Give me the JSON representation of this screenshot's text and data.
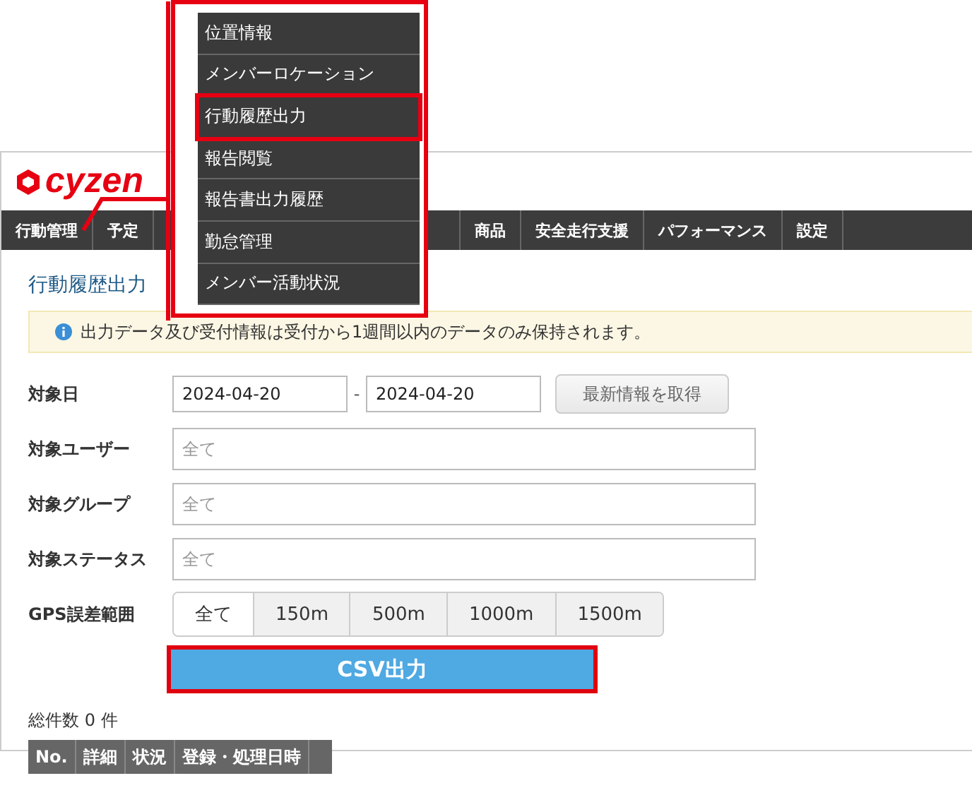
{
  "logo": {
    "text": "cyzen"
  },
  "nav": {
    "items": [
      {
        "label": "行動管理"
      },
      {
        "label": "予定"
      },
      {
        "label": "商品"
      },
      {
        "label": "安全走行支援"
      },
      {
        "label": "パフォーマンス"
      },
      {
        "label": "設定"
      }
    ]
  },
  "dropdown": {
    "items": [
      {
        "label": "位置情報",
        "highlighted": false
      },
      {
        "label": "メンバーロケーション",
        "highlighted": false
      },
      {
        "label": "行動履歴出力",
        "highlighted": true
      },
      {
        "label": "報告閲覧",
        "highlighted": false
      },
      {
        "label": "報告書出力履歴",
        "highlighted": false
      },
      {
        "label": "勤怠管理",
        "highlighted": false
      },
      {
        "label": "メンバー活動状況",
        "highlighted": false
      }
    ]
  },
  "page_title": "行動履歴出力",
  "notice": "出力データ及び受付情報は受付から1週間以内のデータのみ保持されます。",
  "form": {
    "date": {
      "label": "対象日",
      "from": "2024-04-20",
      "separator": "-",
      "to": "2024-04-20",
      "button": "最新情報を取得"
    },
    "fields": [
      {
        "label": "対象ユーザー",
        "placeholder": "全て"
      },
      {
        "label": "対象グループ",
        "placeholder": "全て"
      },
      {
        "label": "対象ステータス",
        "placeholder": "全て"
      }
    ],
    "gps": {
      "label": "GPS誤差範囲",
      "options": [
        {
          "label": "全て",
          "selected": true
        },
        {
          "label": "150m",
          "selected": false
        },
        {
          "label": "500m",
          "selected": false
        },
        {
          "label": "1000m",
          "selected": false
        },
        {
          "label": "1500m",
          "selected": false
        }
      ]
    }
  },
  "csv_button": {
    "label": "CSV出力",
    "highlighted": true
  },
  "total": "総件数 0 件",
  "table": {
    "columns": [
      "No.",
      "詳細",
      "状況",
      "登録・処理日時"
    ]
  }
}
